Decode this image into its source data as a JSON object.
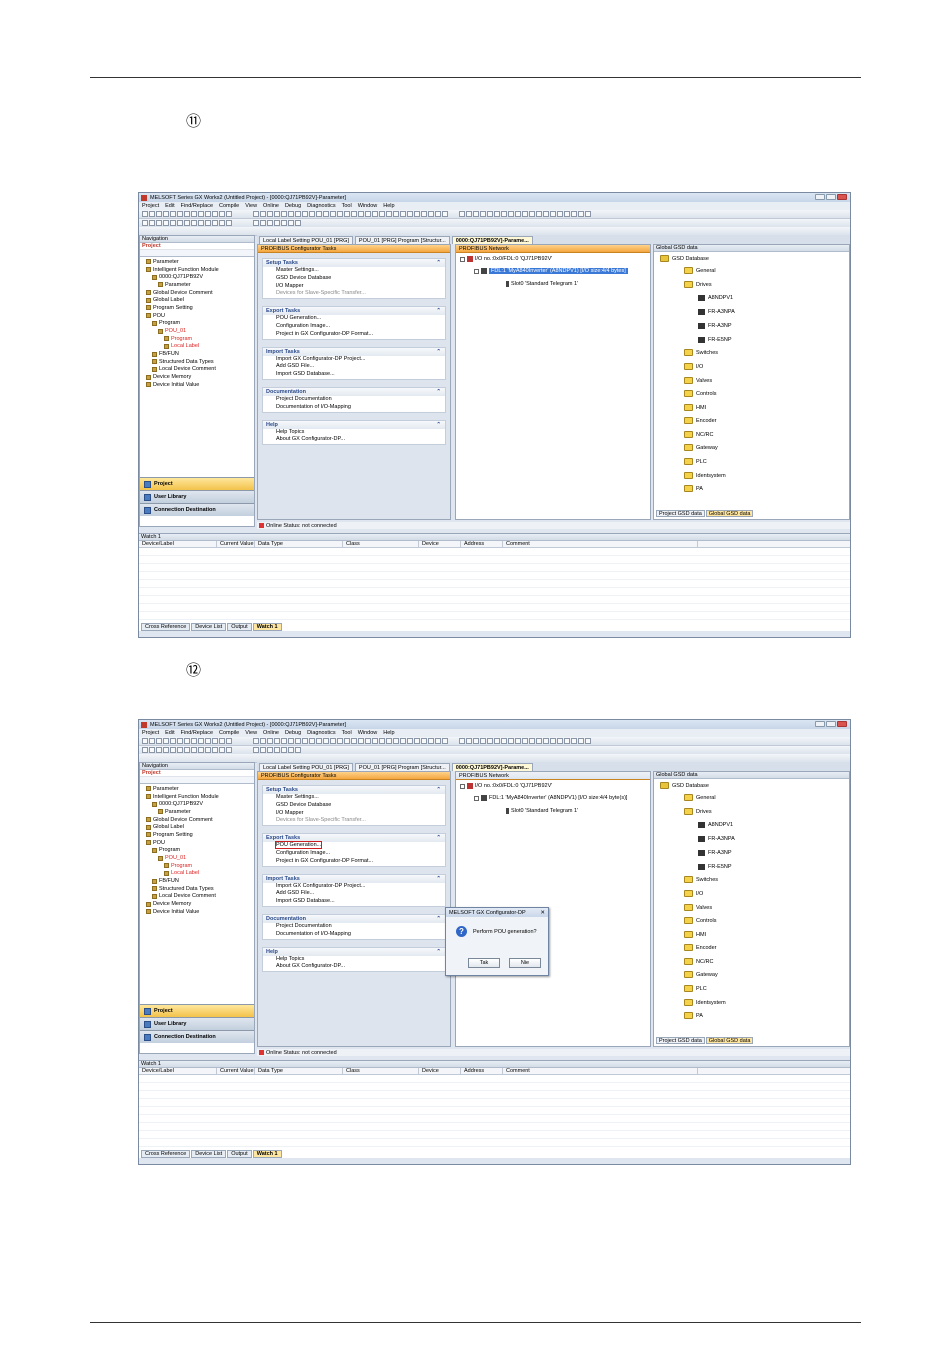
{
  "step1": {
    "marker": "⑪"
  },
  "step2": {
    "marker": "⑫"
  },
  "app": {
    "title": "MELSOFT Series GX Works2 (Untitled Project) - [0000:QJ71PB92V]-Parameter]",
    "menu": [
      "Project",
      "Edit",
      "Find/Replace",
      "Compile",
      "View",
      "Online",
      "Debug",
      "Diagnostics",
      "Tool",
      "Window",
      "Help"
    ],
    "tabs": [
      "Local Label Setting POU_01 [PRG]",
      "POU_01 [PRG] Program [Structur...",
      "0000:QJ71PB92V]-Parame..."
    ],
    "navigation": {
      "title": "Navigation",
      "subtitle": "Project",
      "tree": [
        {
          "label": "Parameter",
          "red": false
        },
        {
          "label": "Intelligent Function Module",
          "red": false
        },
        {
          "label": "0000:QJ71PB92V",
          "red": false
        },
        {
          "label": "Parameter",
          "red": false
        },
        {
          "label": "Global Device Comment",
          "red": false
        },
        {
          "label": "Global Label",
          "red": false
        },
        {
          "label": "Program Setting",
          "red": false
        },
        {
          "label": "POU",
          "red": false
        },
        {
          "label": "Program",
          "red": false
        },
        {
          "label": "POU_01",
          "red": true
        },
        {
          "label": "Program",
          "red": true
        },
        {
          "label": "Local Label",
          "red": true
        },
        {
          "label": "FB/FUN",
          "red": false
        },
        {
          "label": "Structured Data Types",
          "red": false
        },
        {
          "label": "Local Device Comment",
          "red": false
        },
        {
          "label": "Device Memory",
          "red": false
        },
        {
          "label": "Device Initial Value",
          "red": false
        }
      ],
      "buttons": [
        "Project",
        "User Library",
        "Connection Destination"
      ]
    },
    "tasks": {
      "title": "PROFIBUS Configurator Tasks",
      "groups": [
        {
          "title": "Setup Tasks",
          "items": [
            "Master Settings...",
            "GSD Device Database",
            "I/O Mapper",
            "Devices for Slave-Specific Transfer..."
          ]
        },
        {
          "title": "Export Tasks",
          "items": [
            "POU Generation...",
            "Configuration Image...",
            "Project in GX Configurator-DP Format..."
          ]
        },
        {
          "title": "Import Tasks",
          "items": [
            "Import GX Configurator-DP Project...",
            "Add GSD File...",
            "Import GSD Database..."
          ]
        },
        {
          "title": "Documentation",
          "items": [
            "Project Documentation",
            "Documentation of I/O-Mapping"
          ]
        },
        {
          "title": "Help",
          "items": [
            "Help Topics",
            "About GX Configurator-DP..."
          ]
        }
      ]
    },
    "network": {
      "title": "PROFIBUS Network",
      "master": "I/O no.:0x0/FDL:0 'QJ71PB92V'",
      "slave": "FDL:1 'MyA840Inverter' (A8NDPV1) [I/O size:4/4 bytes]",
      "slave_alt": "FDL:1 'MyA840Inverter' (A8NDPV1) [I/O size:4/4 byte(s)]",
      "slot": "Slot0 'Standard Telegram 1'"
    },
    "gsd": {
      "title": "Global GSD data",
      "root": "GSD Database",
      "items": [
        "General",
        "Drives",
        "A8NDPV1",
        "FR-A3NPA",
        "FR-A3NP",
        "FR-E5NP",
        "Switches",
        "I/O",
        "Valves",
        "Controls",
        "HMI",
        "Encoder",
        "NC/RC",
        "Gateway",
        "PLC",
        "Identsystem",
        "PA"
      ],
      "tabs": [
        "Project GSD data",
        "Global GSD data"
      ]
    },
    "status": "Online Status: not connected",
    "watch": {
      "title": "Watch 1",
      "columns": [
        "Device/Label",
        "Current Value",
        "Data Type",
        "Class",
        "Device",
        "Address",
        "Comment"
      ],
      "tabs": [
        "Cross Reference",
        "Device List",
        "Output",
        "Watch 1"
      ]
    },
    "dialog": {
      "title": "MELSOFT GX Configurator-DP",
      "message": "Perform POU generation?",
      "yes": "Tak",
      "no": "Nie"
    }
  }
}
